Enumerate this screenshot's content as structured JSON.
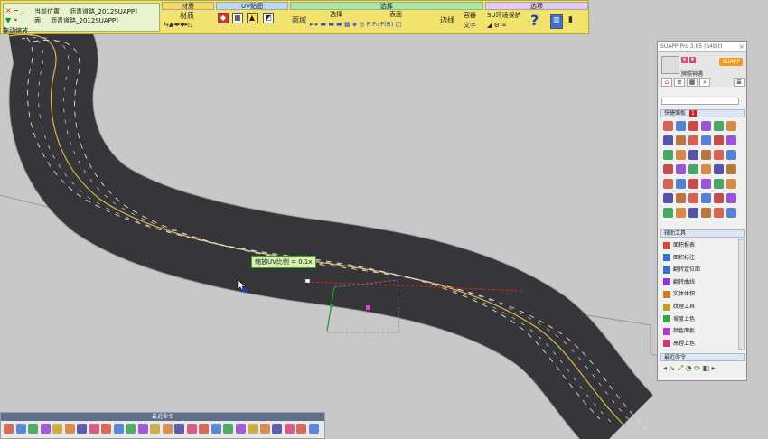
{
  "toolbar": {
    "location_label": "当前位置：",
    "location_value": "沥青道路_2012SUAPP]",
    "face_label": "面：",
    "face_value": "沥青道路_2012SUAPP]",
    "status_text": "拖动缩放",
    "groups": {
      "material": {
        "title": "材质",
        "label": "材质"
      },
      "uv": {
        "title": "UV贴图"
      },
      "select": {
        "title": "选择",
        "sub_select": "选择",
        "sub_surface": "表面",
        "face_btn": "面域",
        "edge_btn": "边线",
        "container_btn": "容器",
        "text_btn": "文字"
      },
      "options": {
        "title": "选项",
        "protect_label": "SU环境保护"
      }
    }
  },
  "viewport": {
    "tooltip": "缩放UV比例 = 0.1x",
    "colors": {
      "asphalt": "#3a3a3e",
      "lane_yellow": "#d9b84a",
      "lane_white": "#dcdcdc",
      "ground": "#c8c8c8"
    }
  },
  "panel": {
    "title": "SUAPP Pro 3.85 (64bit)",
    "close": "×",
    "logo": "SUAPP",
    "user": "牌照神遇",
    "quick_panel": "快捷面板",
    "quick_badge": "1",
    "aux_tools": "辅助工具",
    "recent": "最近命令",
    "tools": [
      {
        "label": "面积报表",
        "color": "#d04a3a"
      },
      {
        "label": "面积标注",
        "color": "#3a6fd0"
      },
      {
        "label": "翻转定位面",
        "color": "#3a6fd0"
      },
      {
        "label": "翻转曲线",
        "color": "#8b3ad0"
      },
      {
        "label": "实体体积",
        "color": "#d07a2a"
      },
      {
        "label": "纹理工具",
        "color": "#c0a020"
      },
      {
        "label": "坡度上色",
        "color": "#3aa04a"
      },
      {
        "label": "颜色面板",
        "color": "#b03ad0"
      },
      {
        "label": "高程上色",
        "color": "#d03a6a"
      }
    ]
  },
  "bottom": {
    "title": "最近命令"
  }
}
